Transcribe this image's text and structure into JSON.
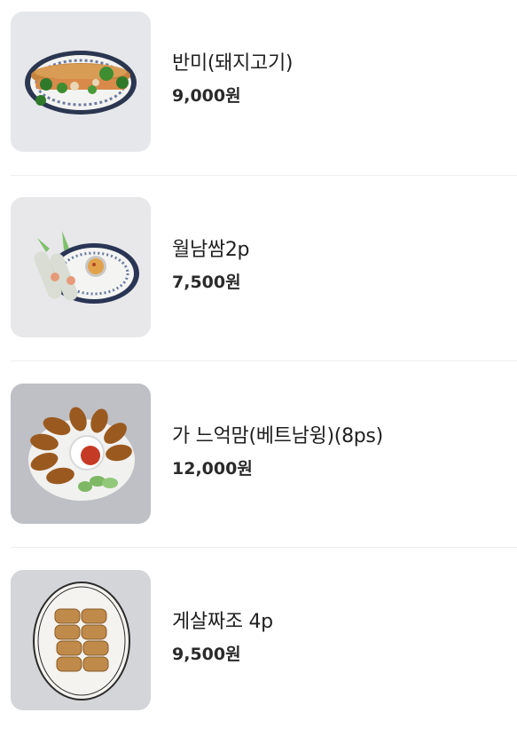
{
  "menu": {
    "items": [
      {
        "name": "반미(돼지고기)",
        "price": "9,000원",
        "image_icon": "banh-mi-icon"
      },
      {
        "name": "월남쌈2p",
        "price": "7,500원",
        "image_icon": "spring-roll-icon"
      },
      {
        "name": "가 느억맘(베트남윙)(8ps)",
        "price": "12,000원",
        "image_icon": "chicken-wings-icon"
      },
      {
        "name": "게살짜조 4p",
        "price": "9,500원",
        "image_icon": "fried-rolls-icon"
      }
    ]
  },
  "colors": {
    "background": "#ffffff",
    "text": "#1f1f1f",
    "divider": "#eeeeee"
  }
}
